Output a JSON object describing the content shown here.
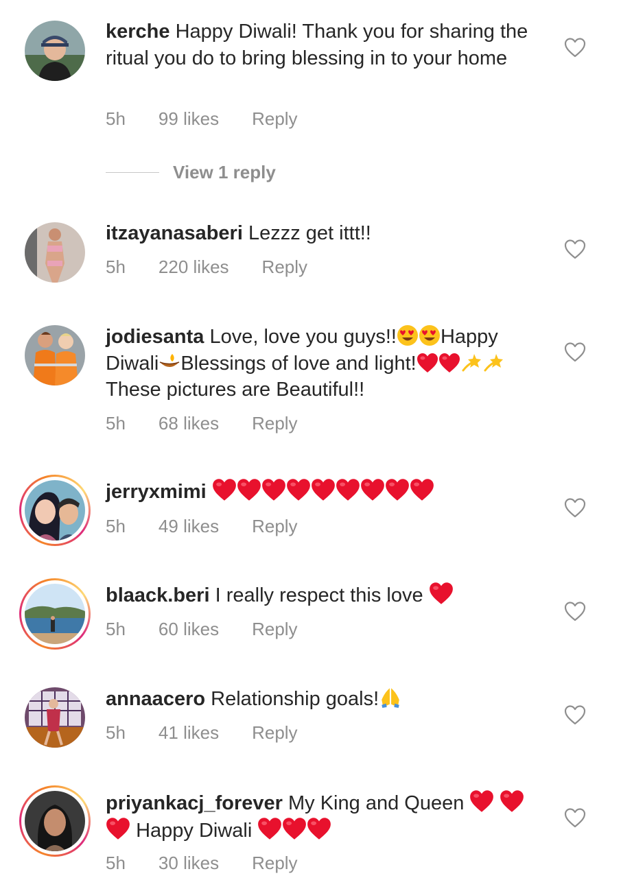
{
  "comments": [
    {
      "username": "kerche",
      "text": "Happy Diwali! Thank you for sharing the ritual you do to bring blessing in to your home",
      "time": "5h",
      "likes": "99 likes",
      "reply": "Reply",
      "view_replies": "View 1 reply"
    },
    {
      "username": "itzayanasaberi",
      "text": "Lezzz get ittt!!",
      "time": "5h",
      "likes": "220 likes",
      "reply": "Reply"
    },
    {
      "username": "jodiesanta",
      "text_parts": [
        "Love, love you guys!!",
        "Happy Diwali",
        "Blessings of love and light!",
        "These pictures are Beautiful!!"
      ],
      "time": "5h",
      "likes": "68 likes",
      "reply": "Reply"
    },
    {
      "username": "jerryxmimi",
      "text": "",
      "time": "5h",
      "likes": "49 likes",
      "reply": "Reply"
    },
    {
      "username": "blaack.beri",
      "text": "I really respect this love",
      "time": "5h",
      "likes": "60 likes",
      "reply": "Reply"
    },
    {
      "username": "annaacero",
      "text": "Relationship goals!",
      "time": "5h",
      "likes": "41 likes",
      "reply": "Reply"
    },
    {
      "username": "priyankacj_forever",
      "text_parts": [
        "My King and Queen",
        "Happy Diwali"
      ],
      "time": "5h",
      "likes": "30 likes",
      "reply": "Reply"
    }
  ],
  "colors": {
    "text": "#262626",
    "meta": "#8e8e8e",
    "heart_emoji": "#e8112d",
    "ring_start": "#f58529",
    "ring_end": "#dd2a7b"
  },
  "icons": {
    "like": "heart-outline-icon",
    "emoji_heart": "red-heart-emoji",
    "emoji_heart_eyes": "heart-eyes-emoji",
    "emoji_diya": "diya-lamp-emoji",
    "emoji_sparkle": "dizzy-star-emoji",
    "emoji_pray": "folded-hands-emoji"
  }
}
